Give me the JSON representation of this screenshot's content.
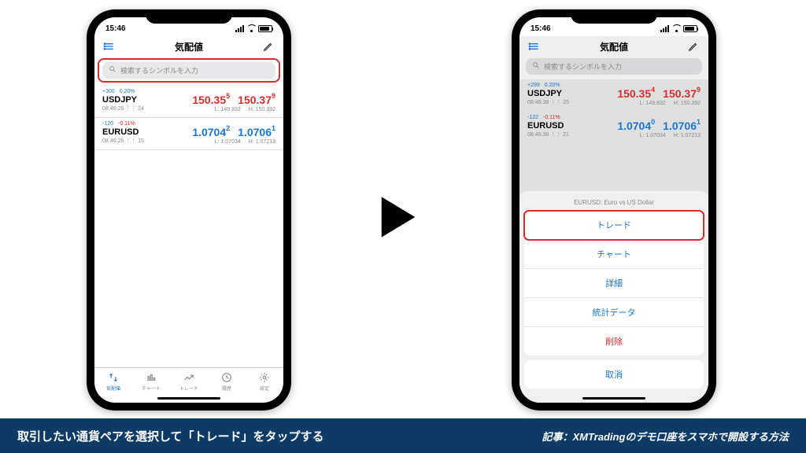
{
  "statusbar": {
    "time": "15:46"
  },
  "header": {
    "title": "気配値"
  },
  "search": {
    "placeholder": "検索するシンボルを入力"
  },
  "left": {
    "rows": [
      {
        "spread": "+300",
        "pct": "0.20%",
        "pct_dir": "up",
        "symbol": "USDJPY",
        "time": "08:46:26 ⋮⋮ 24",
        "bid_main": "150.35",
        "bid_sup": "5",
        "ask_main": "150.37",
        "ask_sup": "9",
        "dir": "down",
        "low": "L: 149.832",
        "high": "H: 150.392"
      },
      {
        "spread": "-120",
        "pct": "-0.11%",
        "pct_dir": "down",
        "symbol": "EURUSD",
        "time": "08:46:26 ⋮⋮ 19",
        "bid_main": "1.0704",
        "bid_sup": "2",
        "ask_main": "1.0706",
        "ask_sup": "1",
        "dir": "up",
        "low": "L: 1.07034",
        "high": "H: 1.07213"
      }
    ]
  },
  "right": {
    "rows": [
      {
        "spread": "+299",
        "pct": "0.20%",
        "pct_dir": "up",
        "symbol": "USDJPY",
        "time": "08:46:38 ⋮⋮ 25",
        "bid_main": "150.35",
        "bid_sup": "4",
        "ask_main": "150.37",
        "ask_sup": "9",
        "dir": "down",
        "low": "L: 149.832",
        "high": "H: 150.392"
      },
      {
        "spread": "-122",
        "pct": "-0.11%",
        "pct_dir": "down",
        "symbol": "EURUSD",
        "time": "08:46:38 ⋮⋮ 21",
        "bid_main": "1.0704",
        "bid_sup": "0",
        "ask_main": "1.0706",
        "ask_sup": "1",
        "dir": "up",
        "low": "L: 1.07034",
        "high": "H: 1.07213"
      }
    ],
    "sheet": {
      "header": "EURUSD: Euro vs US Dollar",
      "items": [
        "トレード",
        "チャート",
        "詳細",
        "統計データ",
        "削除"
      ],
      "cancel": "取消"
    }
  },
  "tabs": [
    {
      "label": "気配値"
    },
    {
      "label": "チャート"
    },
    {
      "label": "トレード"
    },
    {
      "label": "履歴"
    },
    {
      "label": "設定"
    }
  ],
  "footer": {
    "left": "取引したい通貨ペアを選択して「トレード」をタップする",
    "right": "記事：XMTradingのデモ口座をスマホで開設する方法"
  }
}
